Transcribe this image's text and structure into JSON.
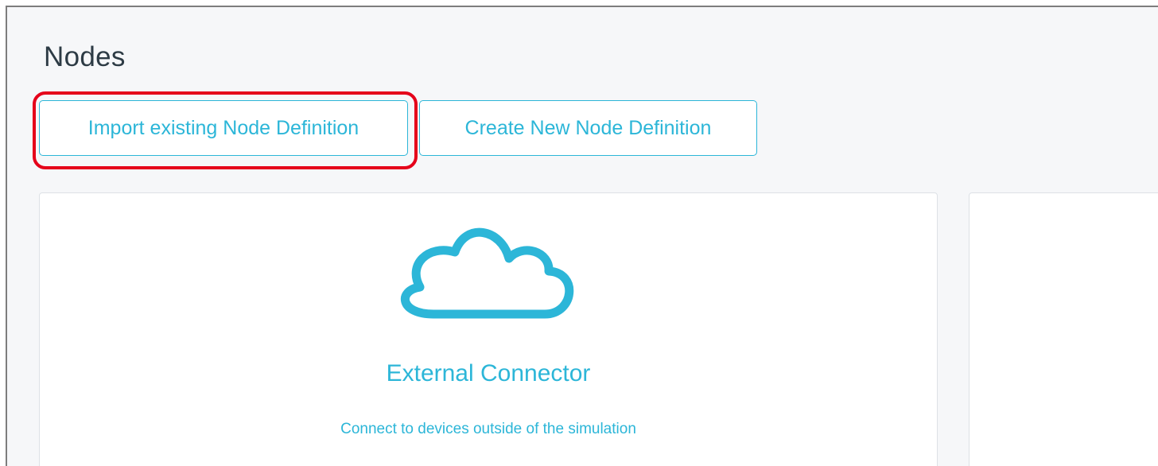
{
  "page": {
    "title": "Nodes"
  },
  "toolbar": {
    "import_label": "Import existing Node Definition",
    "create_label": "Create New Node Definition"
  },
  "cards": [
    {
      "icon": "cloud-icon",
      "title": "External Connector",
      "description": "Connect to devices outside of the simulation"
    },
    {
      "title": "",
      "description": ""
    }
  ],
  "colors": {
    "accent": "#2cb6d8",
    "highlight": "#e5001a",
    "background": "#f6f7f9",
    "title_text": "#2d3b45"
  }
}
